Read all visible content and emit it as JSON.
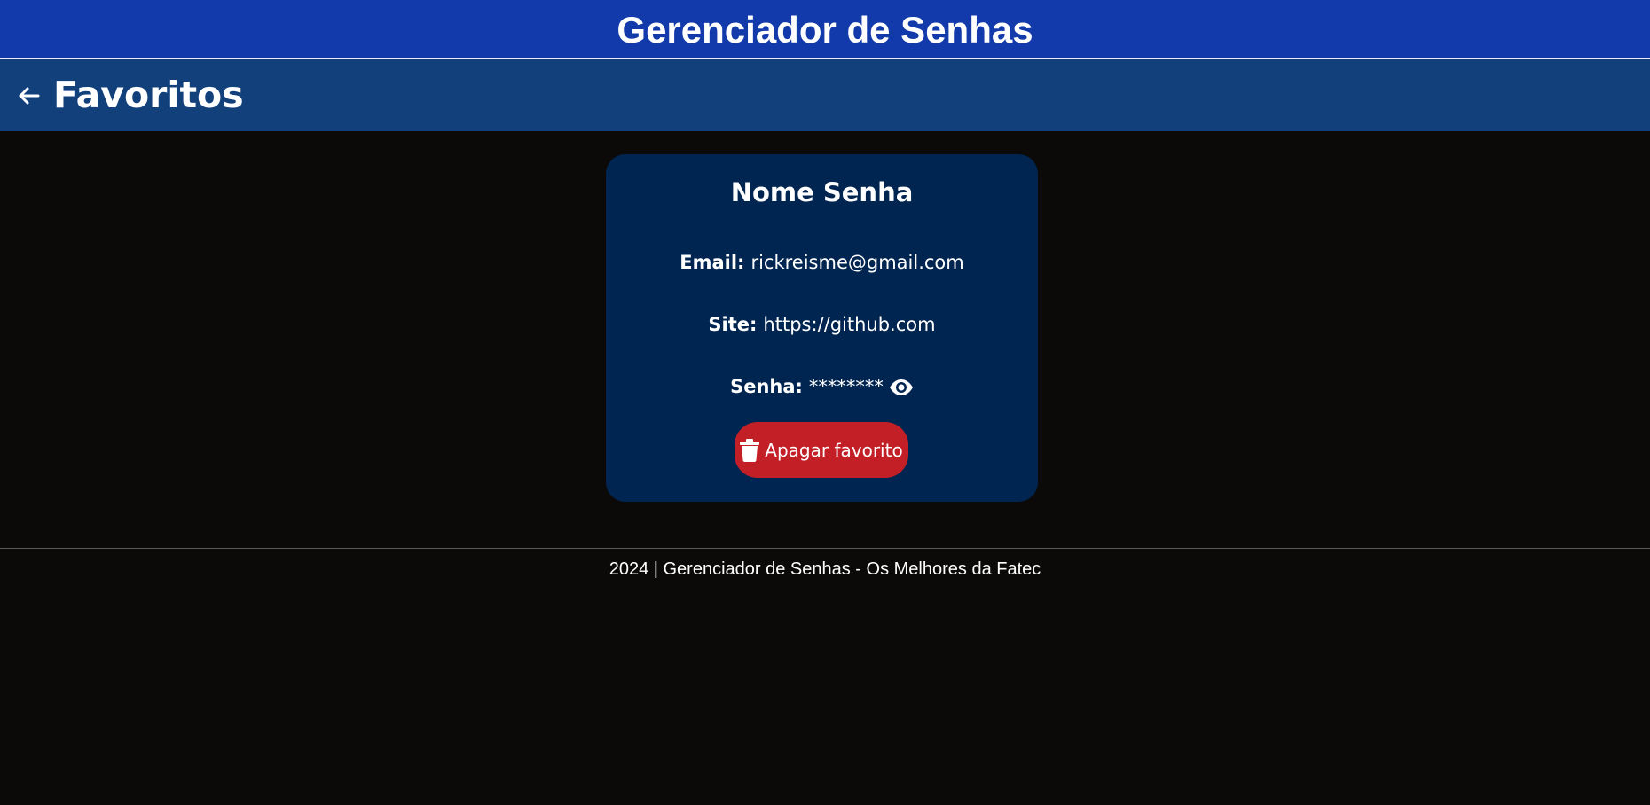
{
  "header": {
    "title": "Gerenciador de Senhas"
  },
  "subheader": {
    "back_icon": "arrow-left-icon",
    "title": "Favoritos"
  },
  "favorite": {
    "name": "Nome Senha",
    "email_label": "Email:",
    "email_value": "rickreisme@gmail.com",
    "site_label": "Site:",
    "site_value": "https://github.com",
    "password_label": "Senha:",
    "password_value": "********",
    "reveal_icon": "eye-icon",
    "delete_icon": "trash-icon",
    "delete_label": "Apagar favorito"
  },
  "footer": {
    "text": "2024 | Gerenciador de Senhas - Os Melhores da Fatec"
  },
  "colors": {
    "header_bg": "#133aaa",
    "subheader_bg": "#12407b",
    "page_bg": "#0b0a09",
    "card_bg": "#012551",
    "delete_button_bg": "#c21f26",
    "text": "#ffffff"
  }
}
